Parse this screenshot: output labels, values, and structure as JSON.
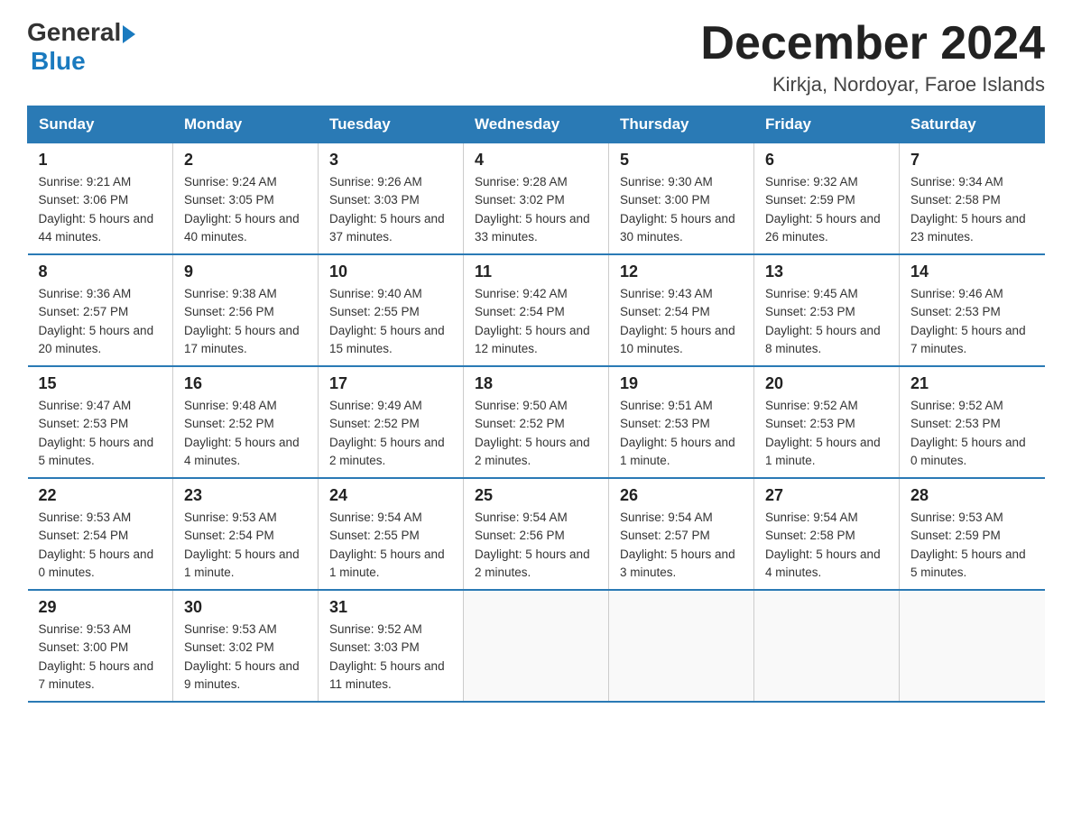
{
  "logo": {
    "general": "General",
    "blue": "Blue"
  },
  "title": "December 2024",
  "location": "Kirkja, Nordoyar, Faroe Islands",
  "days_of_week": [
    "Sunday",
    "Monday",
    "Tuesday",
    "Wednesday",
    "Thursday",
    "Friday",
    "Saturday"
  ],
  "weeks": [
    [
      {
        "day": "1",
        "sunrise": "9:21 AM",
        "sunset": "3:06 PM",
        "daylight": "5 hours and 44 minutes."
      },
      {
        "day": "2",
        "sunrise": "9:24 AM",
        "sunset": "3:05 PM",
        "daylight": "5 hours and 40 minutes."
      },
      {
        "day": "3",
        "sunrise": "9:26 AM",
        "sunset": "3:03 PM",
        "daylight": "5 hours and 37 minutes."
      },
      {
        "day": "4",
        "sunrise": "9:28 AM",
        "sunset": "3:02 PM",
        "daylight": "5 hours and 33 minutes."
      },
      {
        "day": "5",
        "sunrise": "9:30 AM",
        "sunset": "3:00 PM",
        "daylight": "5 hours and 30 minutes."
      },
      {
        "day": "6",
        "sunrise": "9:32 AM",
        "sunset": "2:59 PM",
        "daylight": "5 hours and 26 minutes."
      },
      {
        "day": "7",
        "sunrise": "9:34 AM",
        "sunset": "2:58 PM",
        "daylight": "5 hours and 23 minutes."
      }
    ],
    [
      {
        "day": "8",
        "sunrise": "9:36 AM",
        "sunset": "2:57 PM",
        "daylight": "5 hours and 20 minutes."
      },
      {
        "day": "9",
        "sunrise": "9:38 AM",
        "sunset": "2:56 PM",
        "daylight": "5 hours and 17 minutes."
      },
      {
        "day": "10",
        "sunrise": "9:40 AM",
        "sunset": "2:55 PM",
        "daylight": "5 hours and 15 minutes."
      },
      {
        "day": "11",
        "sunrise": "9:42 AM",
        "sunset": "2:54 PM",
        "daylight": "5 hours and 12 minutes."
      },
      {
        "day": "12",
        "sunrise": "9:43 AM",
        "sunset": "2:54 PM",
        "daylight": "5 hours and 10 minutes."
      },
      {
        "day": "13",
        "sunrise": "9:45 AM",
        "sunset": "2:53 PM",
        "daylight": "5 hours and 8 minutes."
      },
      {
        "day": "14",
        "sunrise": "9:46 AM",
        "sunset": "2:53 PM",
        "daylight": "5 hours and 7 minutes."
      }
    ],
    [
      {
        "day": "15",
        "sunrise": "9:47 AM",
        "sunset": "2:53 PM",
        "daylight": "5 hours and 5 minutes."
      },
      {
        "day": "16",
        "sunrise": "9:48 AM",
        "sunset": "2:52 PM",
        "daylight": "5 hours and 4 minutes."
      },
      {
        "day": "17",
        "sunrise": "9:49 AM",
        "sunset": "2:52 PM",
        "daylight": "5 hours and 2 minutes."
      },
      {
        "day": "18",
        "sunrise": "9:50 AM",
        "sunset": "2:52 PM",
        "daylight": "5 hours and 2 minutes."
      },
      {
        "day": "19",
        "sunrise": "9:51 AM",
        "sunset": "2:53 PM",
        "daylight": "5 hours and 1 minute."
      },
      {
        "day": "20",
        "sunrise": "9:52 AM",
        "sunset": "2:53 PM",
        "daylight": "5 hours and 1 minute."
      },
      {
        "day": "21",
        "sunrise": "9:52 AM",
        "sunset": "2:53 PM",
        "daylight": "5 hours and 0 minutes."
      }
    ],
    [
      {
        "day": "22",
        "sunrise": "9:53 AM",
        "sunset": "2:54 PM",
        "daylight": "5 hours and 0 minutes."
      },
      {
        "day": "23",
        "sunrise": "9:53 AM",
        "sunset": "2:54 PM",
        "daylight": "5 hours and 1 minute."
      },
      {
        "day": "24",
        "sunrise": "9:54 AM",
        "sunset": "2:55 PM",
        "daylight": "5 hours and 1 minute."
      },
      {
        "day": "25",
        "sunrise": "9:54 AM",
        "sunset": "2:56 PM",
        "daylight": "5 hours and 2 minutes."
      },
      {
        "day": "26",
        "sunrise": "9:54 AM",
        "sunset": "2:57 PM",
        "daylight": "5 hours and 3 minutes."
      },
      {
        "day": "27",
        "sunrise": "9:54 AM",
        "sunset": "2:58 PM",
        "daylight": "5 hours and 4 minutes."
      },
      {
        "day": "28",
        "sunrise": "9:53 AM",
        "sunset": "2:59 PM",
        "daylight": "5 hours and 5 minutes."
      }
    ],
    [
      {
        "day": "29",
        "sunrise": "9:53 AM",
        "sunset": "3:00 PM",
        "daylight": "5 hours and 7 minutes."
      },
      {
        "day": "30",
        "sunrise": "9:53 AM",
        "sunset": "3:02 PM",
        "daylight": "5 hours and 9 minutes."
      },
      {
        "day": "31",
        "sunrise": "9:52 AM",
        "sunset": "3:03 PM",
        "daylight": "5 hours and 11 minutes."
      },
      null,
      null,
      null,
      null
    ]
  ]
}
